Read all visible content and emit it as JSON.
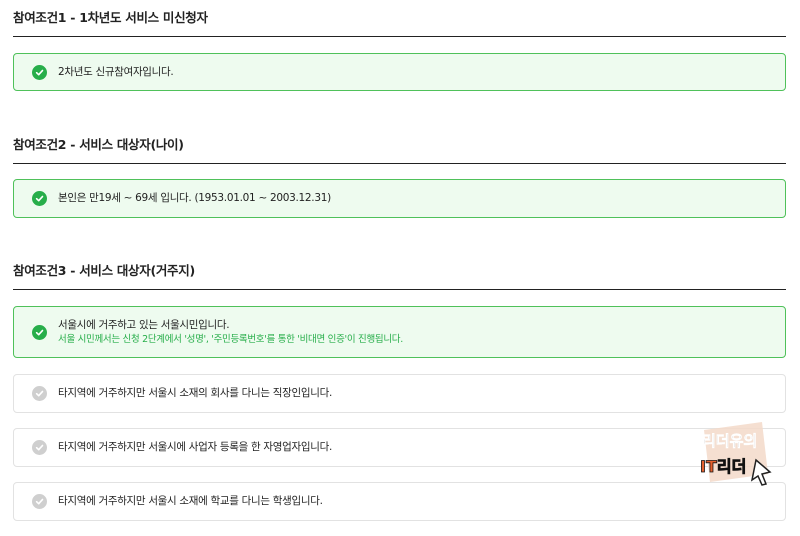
{
  "sections": [
    {
      "title": "참여조건1 - 1차년도 서비스 미신청자",
      "options": [
        {
          "label": "2차년도 신규참여자입니다.",
          "selected": true
        }
      ]
    },
    {
      "title": "참여조건2 - 서비스 대상자(나이)",
      "options": [
        {
          "label": "본인은 만19세 ~ 69세 입니다. (1953.01.01 ~ 2003.12.31)",
          "selected": true
        }
      ]
    },
    {
      "title": "참여조건3 - 서비스 대상자(거주지)",
      "options": [
        {
          "label": "서울시에 거주하고 있는 서울시민입니다.",
          "sub": "서울 시민께서는 신청 2단계에서 '성명', '주민등록번호'를 통한 '비대면 인증'이 진행됩니다.",
          "selected": true
        },
        {
          "label": "타지역에 거주하지만 서울시 소재의 회사를 다니는 직장인입니다.",
          "selected": false
        },
        {
          "label": "타지역에 거주하지만 서울시에 사업자 등록을 한 자영업자입니다.",
          "selected": false
        },
        {
          "label": "타지역에 거주하지만 서울시 소재에 학교를 다니는 학생입니다.",
          "selected": false
        }
      ]
    }
  ],
  "watermark": {
    "line1": "리더유의",
    "line2": "IT리더"
  },
  "colors": {
    "selected_bg": "#eefbef",
    "selected_border": "#4fc15a",
    "check_green": "#27ae4a",
    "check_gray": "#cfcfcf"
  }
}
